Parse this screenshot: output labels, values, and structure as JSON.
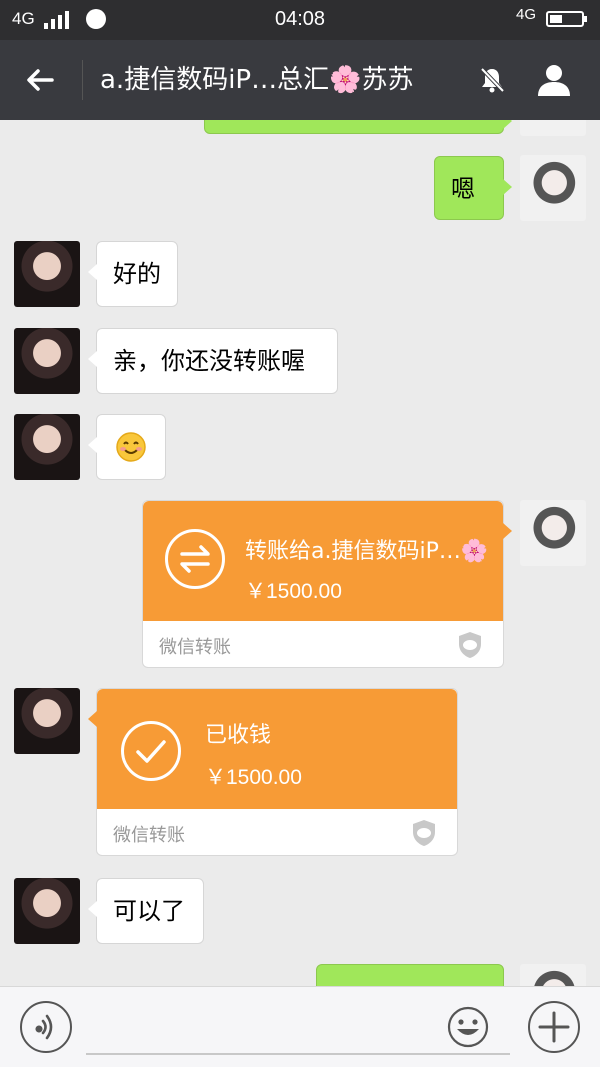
{
  "status_bar": {
    "signal_label": "4G",
    "time": "04:08",
    "network": "4G"
  },
  "header": {
    "title": "a.捷信数码iP…总汇🌸苏苏"
  },
  "messages": {
    "m1": "嗯",
    "m2": "好的",
    "m3": "亲，你还没转账喔",
    "m5": "可以了"
  },
  "transfers": {
    "sent": {
      "title": "转账给a.捷信数码iP…🌸",
      "amount": "￥1500.00",
      "footer": "微信转账"
    },
    "received": {
      "title": "已收钱",
      "amount": "￥1500.00",
      "footer": "微信转账"
    }
  },
  "input": {
    "placeholder": ""
  },
  "colors": {
    "accent_green": "#a0e75a",
    "transfer_orange": "#f79b36",
    "titlebar": "#393a3f"
  }
}
